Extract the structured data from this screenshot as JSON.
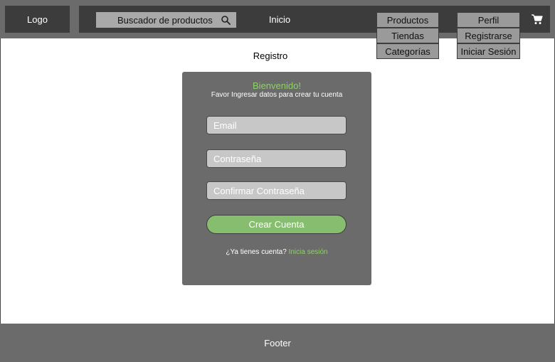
{
  "header": {
    "logo": "Logo",
    "search_placeholder": "Buscador de productos",
    "nav_home": "Inicio",
    "menu_products": [
      "Productos",
      "Tiendas",
      "Categorías"
    ],
    "menu_profile": [
      "Perfil",
      "Registrarse",
      "Iniciar Sesión"
    ],
    "cart_icon": "cart-icon",
    "search_icon": "search-icon"
  },
  "page": {
    "title": "Registro"
  },
  "form": {
    "welcome": "Bienvenido!",
    "subtitle": "Favor Ingresar datos para crear tu cuenta",
    "email_placeholder": "Email",
    "password_placeholder": "Contraseña",
    "confirm_placeholder": "Confirmar Contraseña",
    "submit_label": "Crear Cuenta",
    "login_prompt": "¿Ya tienes cuenta?",
    "login_link": "Inicia sesión"
  },
  "footer": {
    "label": "Footer"
  },
  "colors": {
    "header_bg": "#6b6b6b",
    "nav_bg": "#3c3c3c",
    "accent_green": "#86bd6e",
    "link_green": "#8fd06a",
    "card_bg": "#6b6b6b"
  }
}
